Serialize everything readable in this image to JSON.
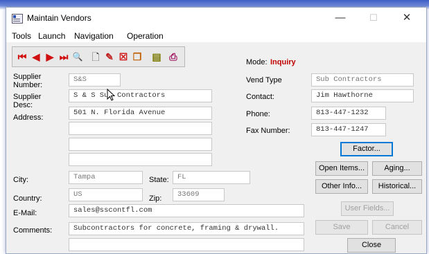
{
  "window": {
    "title": "Maintain Vendors",
    "minimize_glyph": "—",
    "maximize_glyph": "☐",
    "close_glyph": "✕"
  },
  "menu": [
    "Tools",
    "Launch",
    "Navigation",
    "Operation"
  ],
  "toolbar": {
    "icons": [
      "first-record-icon",
      "previous-record-icon",
      "next-record-icon",
      "last-record-icon",
      "find-icon",
      "new-record-icon",
      "edit-icon",
      "delete-icon",
      "copy-icon",
      "notes-icon",
      "print-icon"
    ]
  },
  "mode": {
    "label": "Mode:",
    "value": "Inquiry"
  },
  "labels": {
    "supplier_number": "Supplier Number:",
    "supplier_desc": "Supplier Desc:",
    "address": "Address:",
    "city": "City:",
    "state": "State:",
    "country": "Country:",
    "zip": "Zip:",
    "email": "E-Mail:",
    "comments": "Comments:",
    "vend_type": "Vend Type",
    "contact": "Contact:",
    "phone": "Phone:",
    "fax": "Fax Number:"
  },
  "fields": {
    "supplier_number": "S&S",
    "supplier_desc": "S & S Sub Contractors",
    "address1": "501 N. Florida Avenue",
    "address2": "",
    "address3": "",
    "address4": "",
    "city": "Tampa",
    "state": "FL",
    "country": "US",
    "zip": "33609",
    "email": "sales@sscontfl.com",
    "comments1": "Subcontractors for concrete, framing & drywall.",
    "comments2": "",
    "vend_type": "Sub Contractors",
    "contact": "Jim Hawthorne",
    "phone": "813-447-1232",
    "fax": "813-447-1247"
  },
  "buttons": {
    "factor": "Factor...",
    "open_items": "Open Items...",
    "aging": "Aging...",
    "other_info": "Other Info...",
    "historical": "Historical...",
    "user_fields": "User Fields...",
    "save": "Save",
    "cancel": "Cancel",
    "close": "Close"
  }
}
